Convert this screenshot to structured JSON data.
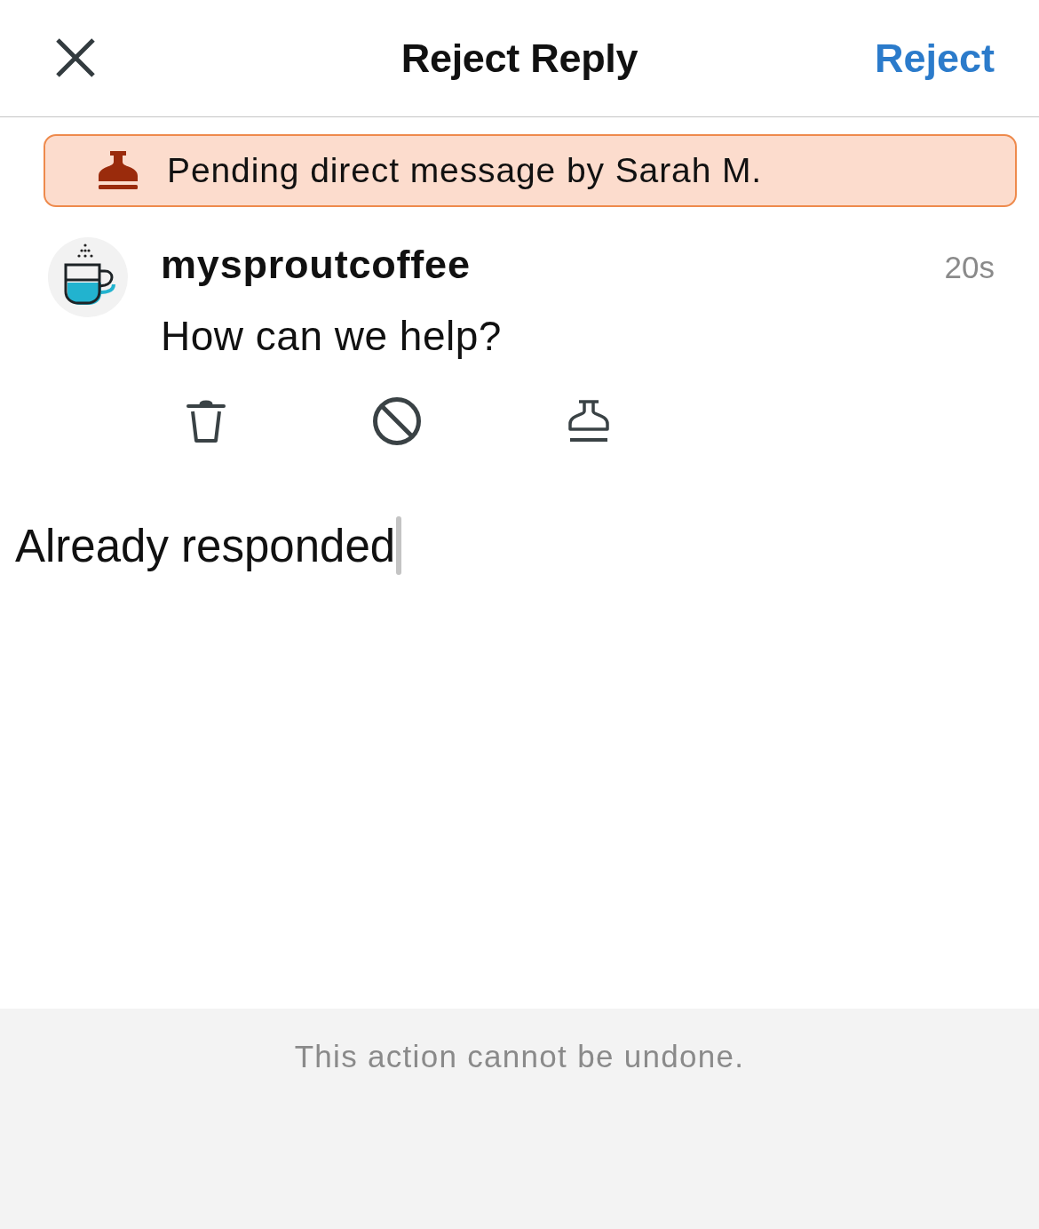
{
  "header": {
    "title": "Reject Reply",
    "action": "Reject"
  },
  "banner": {
    "text": "Pending direct message by Sarah M."
  },
  "message": {
    "author": "mysproutcoffee",
    "time": "20s",
    "text": "How can we help?"
  },
  "reason": {
    "value": "Already responded"
  },
  "footer": {
    "note": "This action cannot be undone."
  }
}
